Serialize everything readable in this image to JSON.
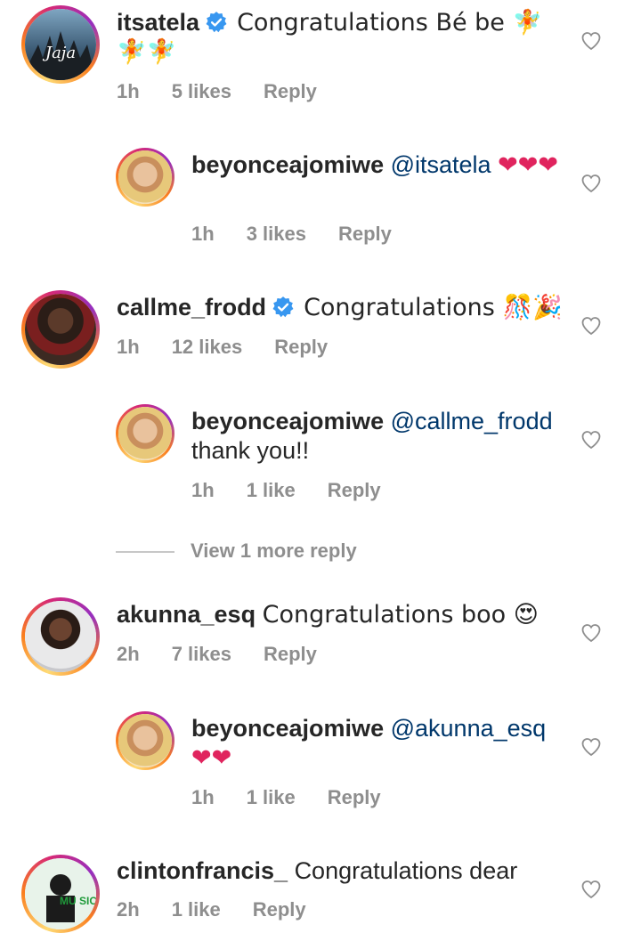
{
  "comments": [
    {
      "username": "itsatela",
      "verified": true,
      "text": "Congratulations Bé be 🧚🧚🧚",
      "time": "1h",
      "likes": "5 likes",
      "reply": "Reply",
      "avatar_icon": "avatar-itsatela",
      "avatar_text": "Jaja",
      "replies": [
        {
          "username": "beyonceajomiwe",
          "mention": "@itsatela",
          "text": "❤❤❤",
          "time": "1h",
          "likes": "3 likes",
          "reply": "Reply"
        }
      ]
    },
    {
      "username": "callme_frodd",
      "verified": true,
      "text": "Congratulations 🎊🎉",
      "time": "1h",
      "likes": "12 likes",
      "reply": "Reply",
      "replies": [
        {
          "username": "beyonceajomiwe",
          "mention": "@callme_frodd",
          "text": "thank you!!",
          "time": "1h",
          "likes": "1 like",
          "reply": "Reply"
        }
      ],
      "view_more": "View 1 more reply"
    },
    {
      "username": "akunna_esq",
      "verified": false,
      "text": "Congratulations boo 😍",
      "time": "2h",
      "likes": "7 likes",
      "reply": "Reply",
      "replies": [
        {
          "username": "beyonceajomiwe",
          "mention": "@akunna_esq",
          "text": "❤❤",
          "time": "1h",
          "likes": "1 like",
          "reply": "Reply"
        }
      ]
    },
    {
      "username": "clintonfrancis_",
      "verified": false,
      "text": "Congratulations dear",
      "time": "2h",
      "likes": "1 like",
      "reply": "Reply",
      "avatar_text": "MU SIC"
    }
  ],
  "colors": {
    "text": "#262626",
    "meta": "#8e8e8e",
    "mention": "#00376b",
    "verified": "#3897f0",
    "heart_red": "#e0245e"
  }
}
